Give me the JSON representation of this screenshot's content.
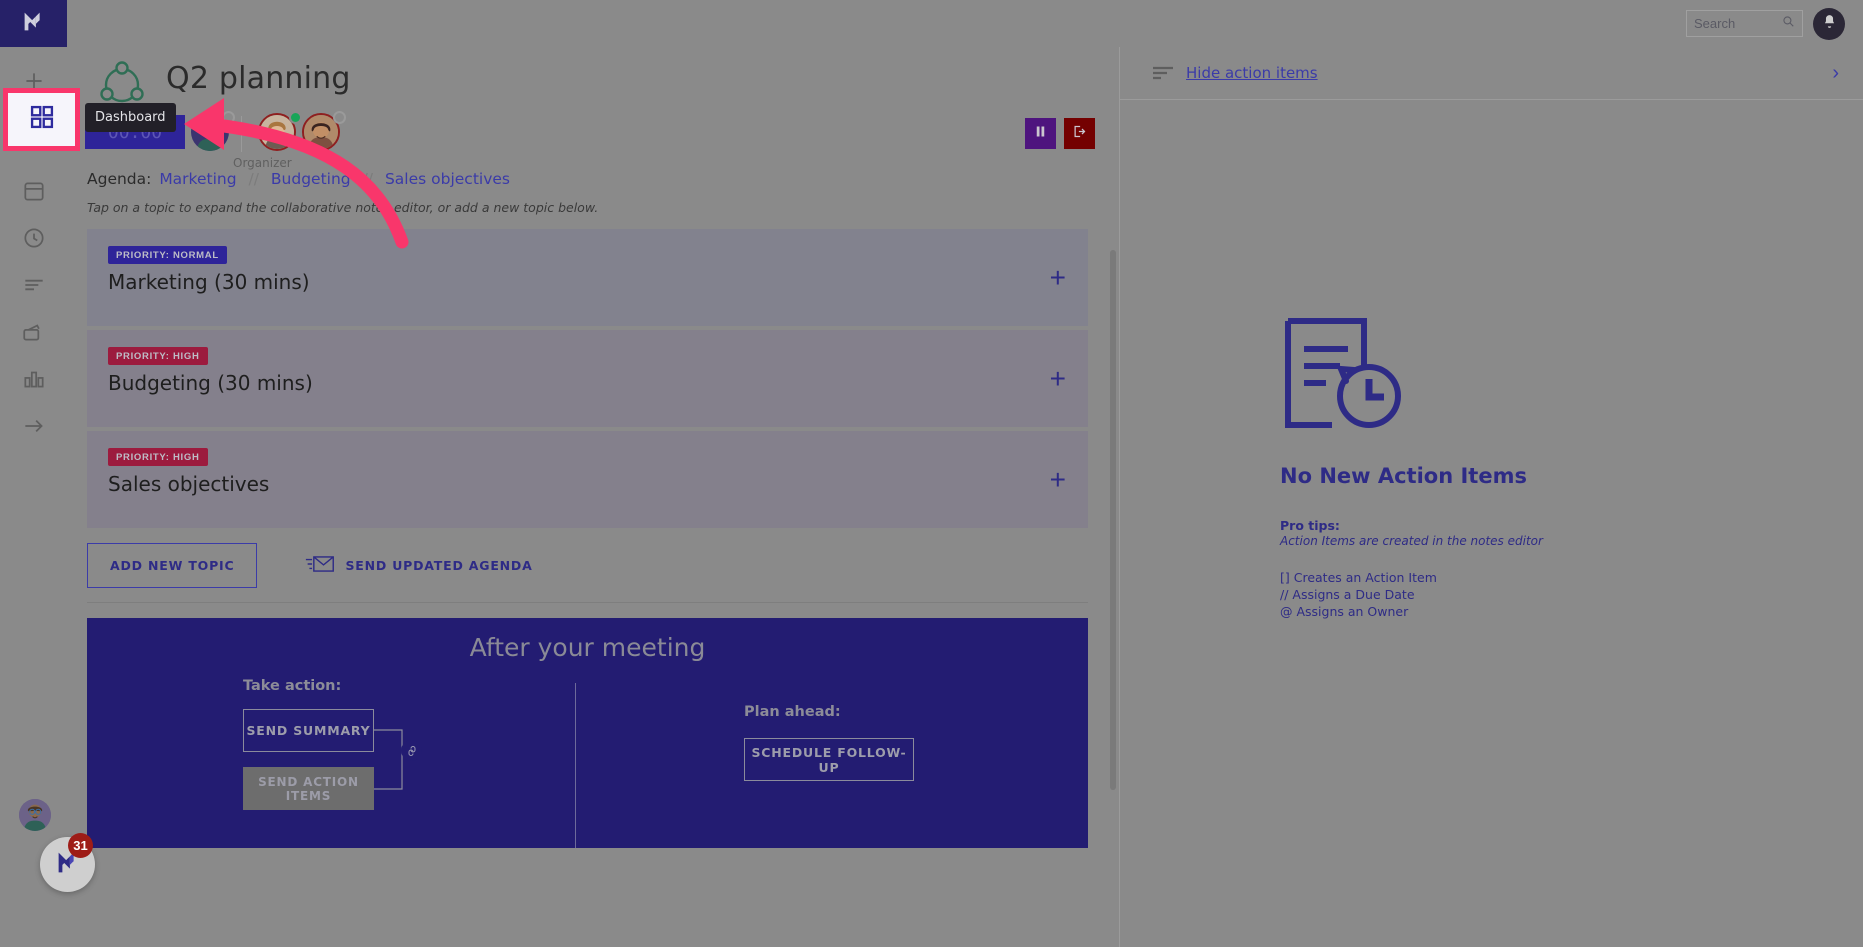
{
  "app": {
    "logo_icon": "meetingapp-logo-icon",
    "brand_color": "#262168"
  },
  "topbar": {
    "search_placeholder": "Search",
    "search_value": "",
    "search_icon": "search-icon",
    "bell_icon": "bell-icon"
  },
  "rail": {
    "items": [
      {
        "name": "add",
        "icon": "plus-icon"
      },
      {
        "name": "dashboard",
        "icon": "grid-icon"
      },
      {
        "name": "calendar",
        "icon": "calendar-icon"
      },
      {
        "name": "history",
        "icon": "clock-icon"
      },
      {
        "name": "notes",
        "icon": "lines-icon"
      },
      {
        "name": "recordings",
        "icon": "video-icon"
      },
      {
        "name": "analytics",
        "icon": "bar-chart-icon"
      },
      {
        "name": "collapse",
        "icon": "arrow-right-icon"
      }
    ],
    "chat_badge_count": "31",
    "highlight_color": "#f9366b"
  },
  "tooltip": {
    "text": "Dashboard"
  },
  "meeting": {
    "icon": "meeting-circle-icon",
    "title": "Q2 planning",
    "timer": "00:00",
    "organizer_label": "Organizer",
    "participants": [
      {
        "name": "participant-1",
        "status": "away"
      },
      {
        "name": "participant-2",
        "status": "online"
      },
      {
        "name": "participant-3",
        "status": "away"
      }
    ],
    "pause_icon": "pause-icon",
    "exit_icon": "exit-icon"
  },
  "agenda": {
    "label": "Agenda:",
    "separator": "//",
    "links": [
      "Marketing",
      "Budgeting",
      "Sales objectives"
    ],
    "hint": "Tap on a topic to expand the collaborative notes editor, or add a new topic below."
  },
  "topics": [
    {
      "priority": "PRIORITY: NORMAL",
      "level": "normal",
      "name": "Marketing (30 mins)",
      "add_icon": "plus-icon"
    },
    {
      "priority": "PRIORITY: HIGH",
      "level": "high",
      "name": "Budgeting (30 mins)",
      "add_icon": "plus-icon"
    },
    {
      "priority": "PRIORITY: HIGH",
      "level": "high",
      "name": "Sales objectives",
      "add_icon": "plus-icon"
    }
  ],
  "topic_actions": {
    "add_new_topic": "ADD NEW TOPIC",
    "send_updated_agenda": "SEND UPDATED AGENDA",
    "envelope_icon": "envelope-icon"
  },
  "after_meeting": {
    "title": "After your meeting",
    "take_action_label": "Take action:",
    "send_summary": "SEND SUMMARY",
    "send_action_items": "SEND ACTION ITEMS",
    "link_icon": "link-icon",
    "plan_ahead_label": "Plan ahead:",
    "schedule_follow_up": "SCHEDULE FOLLOW-UP",
    "panel_color": "#231c72"
  },
  "right_panel": {
    "lines_icon": "lines-icon",
    "hide_action_items": "Hide action items",
    "collapse_icon": "chevron-right-icon",
    "empty_icon": "document-clock-icon",
    "empty_title": "No New Action Items",
    "pro_tips_head": "Pro tips:",
    "pro_tips_sub": "Action Items are created in the notes editor",
    "tips": [
      "[] Creates an Action Item",
      "// Assigns a Due Date",
      "@ Assigns an Owner"
    ]
  }
}
